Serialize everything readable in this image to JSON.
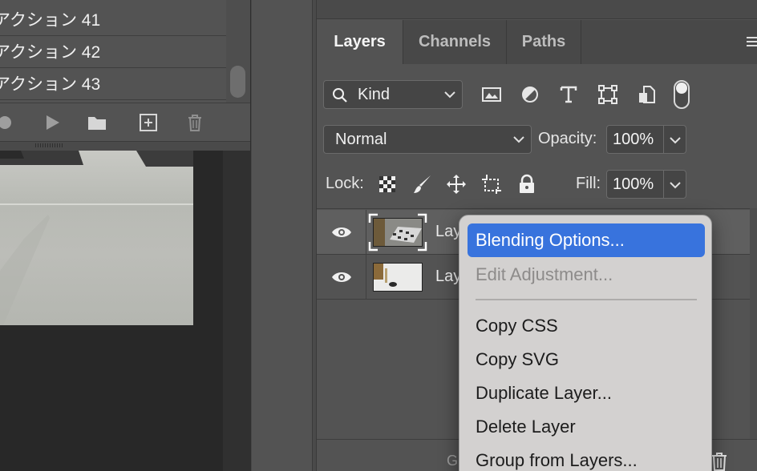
{
  "actions_panel": {
    "rows": [
      "アクション 41",
      "アクション 42",
      "アクション 43"
    ],
    "toolbar_icons": [
      "stop-icon",
      "play-icon",
      "new-set-folder-icon",
      "new-action-icon",
      "trash-icon"
    ]
  },
  "layers_panel": {
    "tabs": [
      {
        "label": "Layers",
        "active": true
      },
      {
        "label": "Channels",
        "active": false
      },
      {
        "label": "Paths",
        "active": false
      }
    ],
    "filter": {
      "kind_label": "Kind",
      "icons": [
        "image-filter-icon",
        "adjustment-filter-icon",
        "type-filter-icon",
        "shape-filter-icon",
        "smart-object-filter-icon"
      ]
    },
    "blend_mode": "Normal",
    "opacity": {
      "label": "Opacity:",
      "value": "100%"
    },
    "lock": {
      "label": "Lock:",
      "icons": [
        "lock-transparency-icon",
        "lock-pixels-icon",
        "lock-position-icon",
        "lock-artboard-icon",
        "lock-all-icon"
      ]
    },
    "fill": {
      "label": "Fill:",
      "value": "100%"
    },
    "layers": [
      {
        "name": "Lay",
        "visible": true,
        "selected": true
      },
      {
        "name": "Lay",
        "visible": true,
        "selected": false
      }
    ],
    "footer_visible_text": "G"
  },
  "context_menu": {
    "items": [
      {
        "label": "Blending Options...",
        "highlighted": true,
        "disabled": false
      },
      {
        "label": "Edit Adjustment...",
        "highlighted": false,
        "disabled": true
      },
      {
        "label": "Copy CSS",
        "highlighted": false,
        "disabled": false
      },
      {
        "label": "Copy SVG",
        "highlighted": false,
        "disabled": false
      },
      {
        "label": "Duplicate Layer...",
        "highlighted": false,
        "disabled": false
      },
      {
        "label": "Delete Layer",
        "highlighted": false,
        "disabled": false
      },
      {
        "label": "Group from Layers...",
        "highlighted": false,
        "disabled": false
      }
    ]
  },
  "colors": {
    "highlight": "#3873dd",
    "panel": "#535353",
    "menu": "#d3d1d0"
  }
}
